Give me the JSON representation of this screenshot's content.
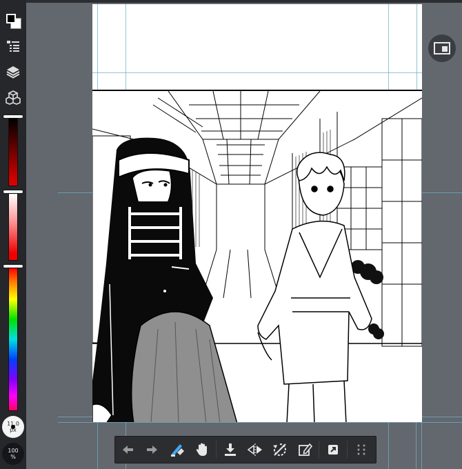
{
  "left_toolbar": {
    "tools": [
      {
        "name": "color-swatch",
        "icon": "fg-bg-color-icon"
      },
      {
        "name": "brush-list",
        "icon": "brush-list-icon"
      },
      {
        "name": "layers",
        "icon": "layers-icon"
      },
      {
        "name": "materials",
        "icon": "materials-icon"
      }
    ],
    "brush_size": {
      "value": "11.0",
      "unit": "px"
    },
    "opacity": {
      "value": "100",
      "unit": "%"
    },
    "colors": {
      "panel": "#25272a",
      "active_color": "#000000",
      "secondary_color": "#ffffff"
    }
  },
  "float_button": {
    "icon": "view-toggle-icon"
  },
  "bottom_toolbar": {
    "items": [
      {
        "icon": "undo-icon"
      },
      {
        "icon": "redo-icon"
      },
      {
        "icon": "pen-eraser-icon",
        "accent": "#3fa9f5"
      },
      {
        "icon": "hand-icon"
      },
      {
        "icon": "import-icon"
      },
      {
        "icon": "flip-horizontal-icon"
      },
      {
        "icon": "rotate-reset-icon"
      },
      {
        "icon": "edit-page-icon"
      },
      {
        "icon": "share-icon"
      },
      {
        "icon": "grid-menu-icon"
      }
    ]
  },
  "canvas": {
    "background": "#ffffff",
    "guide_color": "#6fb0c8"
  }
}
